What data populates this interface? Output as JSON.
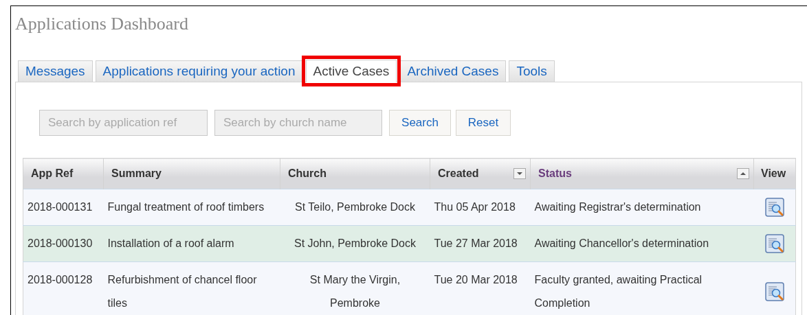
{
  "page_title": "Applications Dashboard",
  "tabs": [
    {
      "label": "Messages",
      "selected": false,
      "highlighted": false
    },
    {
      "label": "Applications requiring your action",
      "selected": false,
      "highlighted": false
    },
    {
      "label": "Active Cases",
      "selected": true,
      "highlighted": true
    },
    {
      "label": "Archived Cases",
      "selected": false,
      "highlighted": false
    },
    {
      "label": "Tools",
      "selected": false,
      "highlighted": false
    }
  ],
  "search": {
    "ref_placeholder": "Search by application ref",
    "church_placeholder": "Search by church name",
    "buttons": [
      "Search",
      "Reset"
    ]
  },
  "table": {
    "columns": [
      {
        "label": "App Ref",
        "sort_down_button": false,
        "sort_up_button": false,
        "sorted": false
      },
      {
        "label": "Summary",
        "sort_down_button": false,
        "sort_up_button": false,
        "sorted": false
      },
      {
        "label": "Church",
        "sort_down_button": false,
        "sort_up_button": false,
        "sorted": false
      },
      {
        "label": "Created",
        "sort_down_button": true,
        "sort_up_button": false,
        "sorted": false
      },
      {
        "label": "Status",
        "sort_down_button": false,
        "sort_up_button": true,
        "sorted": true
      },
      {
        "label": "View",
        "sort_down_button": false,
        "sort_up_button": false,
        "sorted": false
      }
    ],
    "rows": [
      {
        "ref": "2018-000131",
        "summary": "Fungal treatment of roof timbers",
        "church": "St Teilo, Pembroke Dock",
        "created": "Thu 05 Apr 2018",
        "status": "Awaiting Registrar's determination",
        "selected": false
      },
      {
        "ref": "2018-000130",
        "summary": "Installation of a roof alarm",
        "church": "St John, Pembroke Dock",
        "created": "Tue 27 Mar 2018",
        "status": "Awaiting Chancellor's determination",
        "selected": true
      },
      {
        "ref": "2018-000128",
        "summary": "Refurbishment of chancel floor tiles",
        "church": "St Mary the Virgin, Pembroke",
        "created": "Tue 20 Mar 2018",
        "status": "Faculty granted, awaiting Practical Completion",
        "selected": false
      }
    ]
  }
}
